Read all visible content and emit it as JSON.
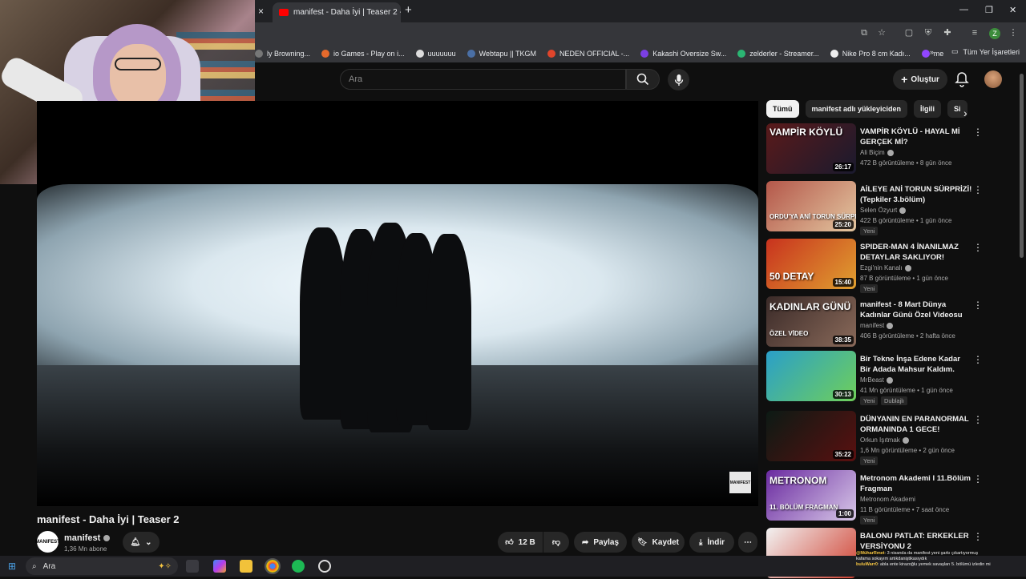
{
  "browser": {
    "tab_title": "manifest - Daha İyi | Teaser 2 -",
    "new_tab": "+",
    "close": "×",
    "bookmarks": [
      {
        "label": "ly Browning...",
        "color": "#777777"
      },
      {
        "label": "io Games - Play on i...",
        "color": "#e66a2c"
      },
      {
        "label": "uuuuuuu",
        "color": "#dddddd"
      },
      {
        "label": "Webtapu || TKGM",
        "color": "#4a6fa5"
      },
      {
        "label": "NEDEN OFFICIAL -...",
        "color": "#e0452b"
      },
      {
        "label": "Kakashi Oversize Sw...",
        "color": "#7b3fe4"
      },
      {
        "label": "zelderler - Streamer...",
        "color": "#2bb673"
      },
      {
        "label": "Nike Pro 8 cm Kadı...",
        "color": "#eeeeee"
      },
      {
        "label": "me",
        "color": "#9146ff"
      }
    ],
    "bookmarks_more": "»",
    "all_bookmarks": "Tüm Yer İşaretleri",
    "profile_initial": "Z"
  },
  "header": {
    "search_placeholder": "Ara",
    "create_label": "Oluştur"
  },
  "video": {
    "title": "manifest - Daha İyi | Teaser 2",
    "watermark": "MANIFEST",
    "channel": "manifest",
    "subscribers": "1,36 Mn abone",
    "channel_avatar_text": "MANIFEST",
    "likes": "12 B",
    "share_label": "Paylaş",
    "save_label": "Kaydet",
    "download_label": "İndir"
  },
  "chips": [
    "Tümü",
    "manifest adlı yükleyiciden",
    "İlgili",
    "Si"
  ],
  "recommendations": [
    {
      "title": "VAMPİR KÖYLÜ - HAYAL Mİ GERÇEK Mİ?",
      "channel": "Ali Biçim",
      "verified": true,
      "meta": "472 B görüntüleme • 8 gün önce",
      "duration": "26:17",
      "thumb_text": "VAMPİR KÖYLÜ",
      "badges": [],
      "thumb_colors": [
        "#5a1a1a",
        "#1a1a2e"
      ]
    },
    {
      "title": "AİLEYE ANİ TORUN SÜRPRİZİ! (Tepkiler 3.bölüm)",
      "channel": "Selen Özyurt",
      "verified": true,
      "meta": "422 B görüntüleme • 1 gün önce",
      "duration": "25:20",
      "thumb_text": "ORDU'YA ANİ TORUN SÜRPRİZİ",
      "badges": [
        "Yeni"
      ],
      "thumb_colors": [
        "#b4574a",
        "#e3c6a0"
      ]
    },
    {
      "title": "SPIDER-MAN 4 İNANILMAZ DETAYLAR SAKLIYOR! Spider-...",
      "channel": "Ezgi'nin Kanalı",
      "verified": true,
      "meta": "87 B görüntüleme • 1 gün önce",
      "duration": "15:40",
      "thumb_text": "50 DETAY",
      "badges": [
        "Yeni"
      ],
      "thumb_colors": [
        "#c8321e",
        "#e0a030"
      ]
    },
    {
      "title": "manifest - 8 Mart Dünya Kadınlar Günü Özel Videosu",
      "channel": "manifest",
      "verified": true,
      "meta": "406 B görüntüleme • 2 hafta önce",
      "duration": "38:35",
      "thumb_text": "KADINLAR GÜNÜ",
      "thumb_text2": "ÖZEL VİDEO",
      "badges": [],
      "thumb_colors": [
        "#3a2a28",
        "#8a6a5a"
      ]
    },
    {
      "title": "Bir Tekne İnşa Edene Kadar Bir Adada Mahsur Kaldım.",
      "channel": "MrBeast",
      "verified": true,
      "meta": "41 Mn görüntüleme • 1 gün önce",
      "duration": "30:13",
      "thumb_text": "",
      "badges": [
        "Yeni",
        "Dublajlı"
      ],
      "thumb_colors": [
        "#2a9fc9",
        "#6fcf5a"
      ]
    },
    {
      "title": "DÜNYANIN EN PARANORMAL ORMANINDA 1 GECE!",
      "channel": "Orkun Işıtmak",
      "verified": true,
      "meta": "1,6 Mn görüntüleme • 2 gün önce",
      "duration": "35:22",
      "thumb_text": "",
      "badges": [
        "Yeni"
      ],
      "thumb_colors": [
        "#0c1a14",
        "#5a1010"
      ]
    },
    {
      "title": "Metronom Akademi I 11.Bölüm Fragman",
      "channel": "Metronom Akademi",
      "verified": false,
      "meta": "11 B görüntüleme • 7 saat önce",
      "duration": "1:00",
      "thumb_text": "METRONOM",
      "thumb_text2": "11. BÖLÜM FRAGMAN",
      "badges": [
        "Yeni"
      ],
      "thumb_colors": [
        "#6a2aa0",
        "#d8c8e8"
      ]
    },
    {
      "title": "BALONU PATLAT: ERKEKLER VERSİYONU 2",
      "channel": "",
      "verified": false,
      "meta": "",
      "duration": "",
      "thumb_text": "",
      "badges": [],
      "thumb_colors": [
        "#f2f2f2",
        "#d04030"
      ]
    }
  ],
  "taskbar": {
    "search_label": "Ara"
  },
  "chat": [
    {
      "user": "@MüharRmet",
      "text": ": 3 nisanda da manifest yeni şarkı çıkartıyormuş"
    },
    {
      "user": "",
      "text": "kafama sokayım artıkdaniştikasıydık"
    },
    {
      "user": "buluWarr0",
      "text": ": abla ente kirazoğlu yemek savaşları 5. bölümü izledin mi"
    }
  ]
}
